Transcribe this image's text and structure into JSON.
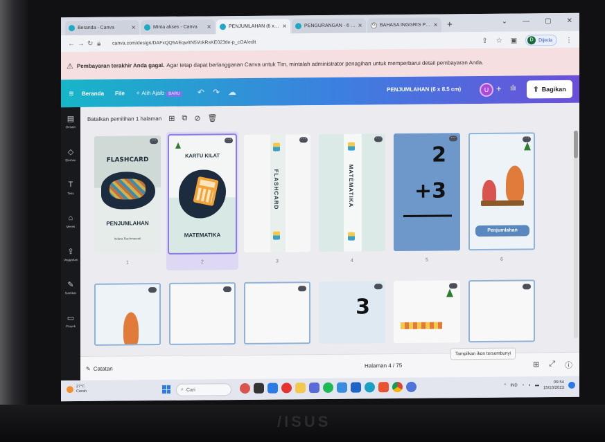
{
  "browser": {
    "tabs": [
      {
        "label": "Beranda - Canva",
        "icon": "canva-icon",
        "active": false
      },
      {
        "label": "Minta akses - Canva",
        "icon": "canva-icon",
        "active": false
      },
      {
        "label": "PENJUMLAHAN (6 x 8.5 cm)",
        "icon": "canva-icon",
        "active": true
      },
      {
        "label": "PENGURANGAN - 6 × 8.5cm",
        "icon": "canva-icon",
        "active": false
      },
      {
        "label": "BAHASA INGGRIS PENJUML",
        "icon": "google-icon",
        "active": false
      }
    ],
    "new_tab": "+",
    "url": "canva.com/design/DAFxQQ5AEqw/tN5VokRsKE023tle-p_cOA/edit",
    "profile_initial": "D",
    "profile_label": "Dijeda"
  },
  "banner": {
    "bold": "Pembayaran terakhir Anda gagal.",
    "text": "Agar tetap dapat berlangganan Canva untuk Tim, mintalah administrator penagihan untuk memperbarui detail pembayaran Anda."
  },
  "header": {
    "home": "Beranda",
    "file": "File",
    "team": "Alih Ajaib",
    "team_badge": "BARU",
    "doc_title": "PENJUMLAHAN (6 x 8.5 cm)",
    "avatar": "U",
    "plus": "+",
    "share": "Bagikan"
  },
  "sidebar": [
    {
      "label": "Desain",
      "icon": "layout-icon"
    },
    {
      "label": "Elemen",
      "icon": "shapes-icon"
    },
    {
      "label": "Teks",
      "icon": "text-icon"
    },
    {
      "label": "Merek",
      "icon": "brand-icon"
    },
    {
      "label": "Unggahan",
      "icon": "upload-icon"
    },
    {
      "label": "Gambar",
      "icon": "draw-icon"
    },
    {
      "label": "Proyek",
      "icon": "folder-icon"
    }
  ],
  "subtoolbar": {
    "label": "Batalkan pemilihan 1 halaman"
  },
  "pages": [
    {
      "number": "1",
      "title": "FLASHCARD",
      "subtitle": "PENJUMLAHAN",
      "author": "Indara Rachmawati"
    },
    {
      "number": "2",
      "title": "KARTU KILAT",
      "subtitle": "MATEMATIKA"
    },
    {
      "number": "3",
      "vertical": "FLASHCARD"
    },
    {
      "number": "4",
      "vertical": "MATEMATIKA"
    },
    {
      "number": "5",
      "top": "2",
      "bottom": "+3"
    },
    {
      "number": "6",
      "pill": "Penjumlahan"
    }
  ],
  "row2_number": "3",
  "status": {
    "notes": "Catatan",
    "page": "Halaman 4 / 75",
    "tooltip": "Tampilkan ikon tersembunyi"
  },
  "taskbar": {
    "temp": "27°C",
    "weather": "Cerah",
    "search": "Cari",
    "lang": "IND",
    "time": "09.54",
    "date": "15/10/2023"
  },
  "colors": {
    "accent": "#8b7be5",
    "header_start": "#17b5c8",
    "header_end": "#6b4fd9"
  }
}
